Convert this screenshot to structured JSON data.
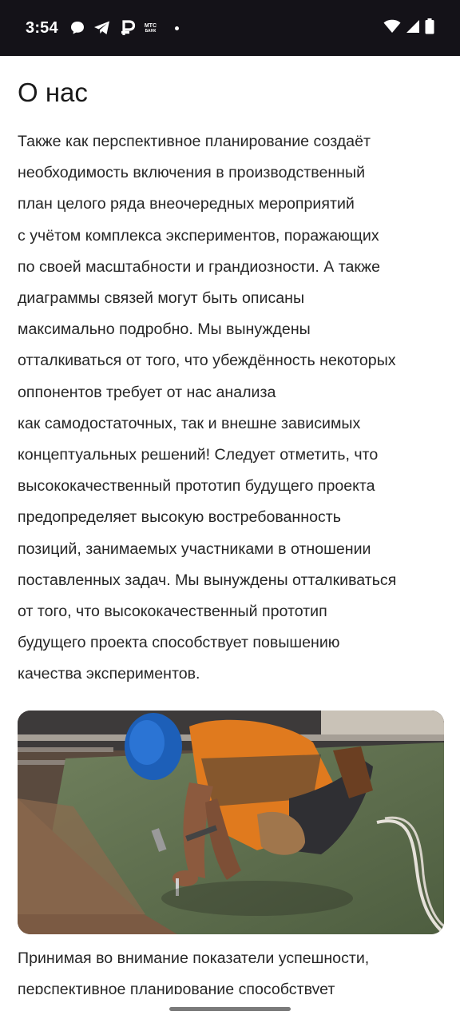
{
  "status_bar": {
    "time": "3:54",
    "notification_icons": [
      "chat-bubble-icon",
      "telegram-icon",
      "ruble-app-icon",
      "mts-bank-icon"
    ],
    "mts_label_top": "МТС",
    "mts_label_bottom": "БАНК",
    "system_icons": [
      "wifi-icon",
      "cellular-signal-icon",
      "battery-icon"
    ]
  },
  "page": {
    "title": "О нас",
    "about_text": "Также как перспективное планирование создаёт\nнеобходимость включения в производственный\nплан целого ряда внеочередных мероприятий\nс учётом комплекса экспериментов, поражающих\nпо своей масштабности и грандиозности. А также\nдиаграммы связей могут быть описаны\nмаксимально подробно. Мы вынуждены\nотталкиваться от того, что убеждённость некоторых\nоппонентов требует от нас анализа\nкак самодостаточных, так и внешне зависимых\nконцептуальных решений! Следует отметить, что\nвысококачественный прототип будущего проекта\nпредопределяет высокую востребованность\nпозиций, занимаемых участниками в отношении\nпоставленных задач. Мы вынуждены отталкиваться\nот того, что высококачественный прототип\nбудущего проекта способствует повышению\nкачества экспериментов.",
    "photo": "construction-worker-hammering-roof-photo",
    "bottom_text": "Принимая во внимание показатели успешности,\nперспективное планирование способствует"
  }
}
